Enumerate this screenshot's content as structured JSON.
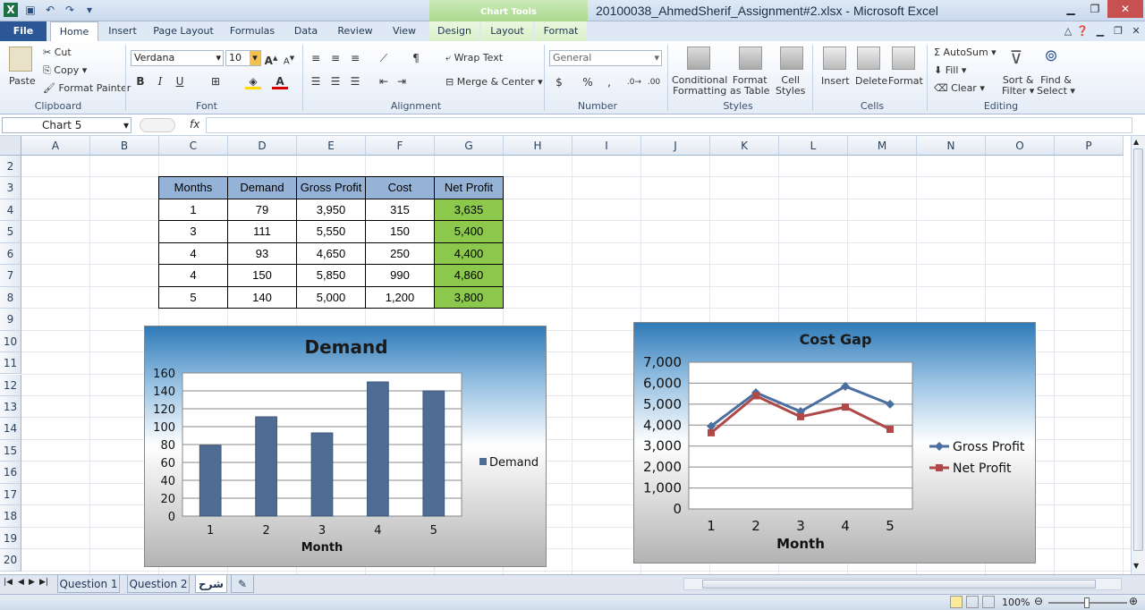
{
  "window": {
    "title": "20100038_AhmedSherif_Assignment#2.xlsx  -  Microsoft Excel",
    "context_group": "Chart Tools"
  },
  "tabs": [
    "File",
    "Home",
    "Insert",
    "Page Layout",
    "Formulas",
    "Data",
    "Review",
    "View",
    "Design",
    "Layout",
    "Format"
  ],
  "ribbon": {
    "clipboard": {
      "label": "Clipboard",
      "paste": "Paste",
      "cut": "Cut",
      "copy": "Copy",
      "format_painter": "Format Painter"
    },
    "font": {
      "label": "Font",
      "name": "Verdana",
      "size": "10"
    },
    "alignment": {
      "label": "Alignment",
      "wrap": "Wrap Text",
      "merge": "Merge & Center"
    },
    "number": {
      "label": "Number",
      "format": "General"
    },
    "styles": {
      "label": "Styles",
      "cond1": "Conditional",
      "cond2": "Formatting",
      "fmt1": "Format",
      "fmt2": "as Table",
      "cell1": "Cell",
      "cell2": "Styles"
    },
    "cells": {
      "label": "Cells",
      "insert": "Insert",
      "delete": "Delete",
      "format": "Format"
    },
    "editing": {
      "label": "Editing",
      "autosum": "AutoSum",
      "fill": "Fill",
      "clear": "Clear",
      "sort1": "Sort &",
      "sort2": "Filter",
      "find1": "Find &",
      "find2": "Select"
    }
  },
  "formula_bar": {
    "name_box": "Chart 5",
    "fx": "fx"
  },
  "columns": [
    "A",
    "B",
    "C",
    "D",
    "E",
    "F",
    "G",
    "H",
    "I",
    "J",
    "K",
    "L",
    "M",
    "N",
    "O",
    "P"
  ],
  "rows": [
    "2",
    "3",
    "4",
    "5",
    "6",
    "7",
    "8",
    "9",
    "10",
    "11",
    "12",
    "13",
    "14",
    "15",
    "16",
    "17",
    "18",
    "19",
    "20"
  ],
  "table": {
    "headers": [
      "Months",
      "Demand",
      "Gross Profit",
      "Cost",
      "Net Profit"
    ],
    "rows": [
      [
        "1",
        "79",
        "3,950",
        "315",
        "3,635"
      ],
      [
        "3",
        "111",
        "5,550",
        "150",
        "5,400"
      ],
      [
        "4",
        "93",
        "4,650",
        "250",
        "4,400"
      ],
      [
        "4",
        "150",
        "5,850",
        "990",
        "4,860"
      ],
      [
        "5",
        "140",
        "5,000",
        "1,200",
        "3,800"
      ]
    ]
  },
  "chart_data": [
    {
      "type": "bar",
      "title": "Demand",
      "xlabel": "Month",
      "ylabel": "",
      "categories": [
        "1",
        "2",
        "3",
        "4",
        "5"
      ],
      "series": [
        {
          "name": "Demand",
          "values": [
            79,
            111,
            93,
            150,
            140
          ],
          "color": "#4f6d94"
        }
      ],
      "ylim": [
        0,
        160
      ],
      "yticks": [
        "0",
        "20",
        "40",
        "60",
        "80",
        "100",
        "120",
        "140",
        "160"
      ],
      "grid": true,
      "legend": "right"
    },
    {
      "type": "line",
      "title": "Cost Gap",
      "xlabel": "Month",
      "ylabel": "",
      "categories": [
        "1",
        "2",
        "3",
        "4",
        "5"
      ],
      "series": [
        {
          "name": "Gross Profit",
          "values": [
            3950,
            5550,
            4650,
            5850,
            5000
          ],
          "color": "#4a6fa0"
        },
        {
          "name": "Net Profit",
          "values": [
            3635,
            5400,
            4400,
            4860,
            3800
          ],
          "color": "#b04848"
        }
      ],
      "ylim": [
        0,
        7000
      ],
      "yticks": [
        "0",
        "1,000",
        "2,000",
        "3,000",
        "4,000",
        "5,000",
        "6,000",
        "7,000"
      ],
      "grid": true,
      "legend": "right"
    }
  ],
  "sheets": [
    "Question 1",
    "Question 2",
    "شرح"
  ],
  "status": {
    "zoom": "100%"
  }
}
